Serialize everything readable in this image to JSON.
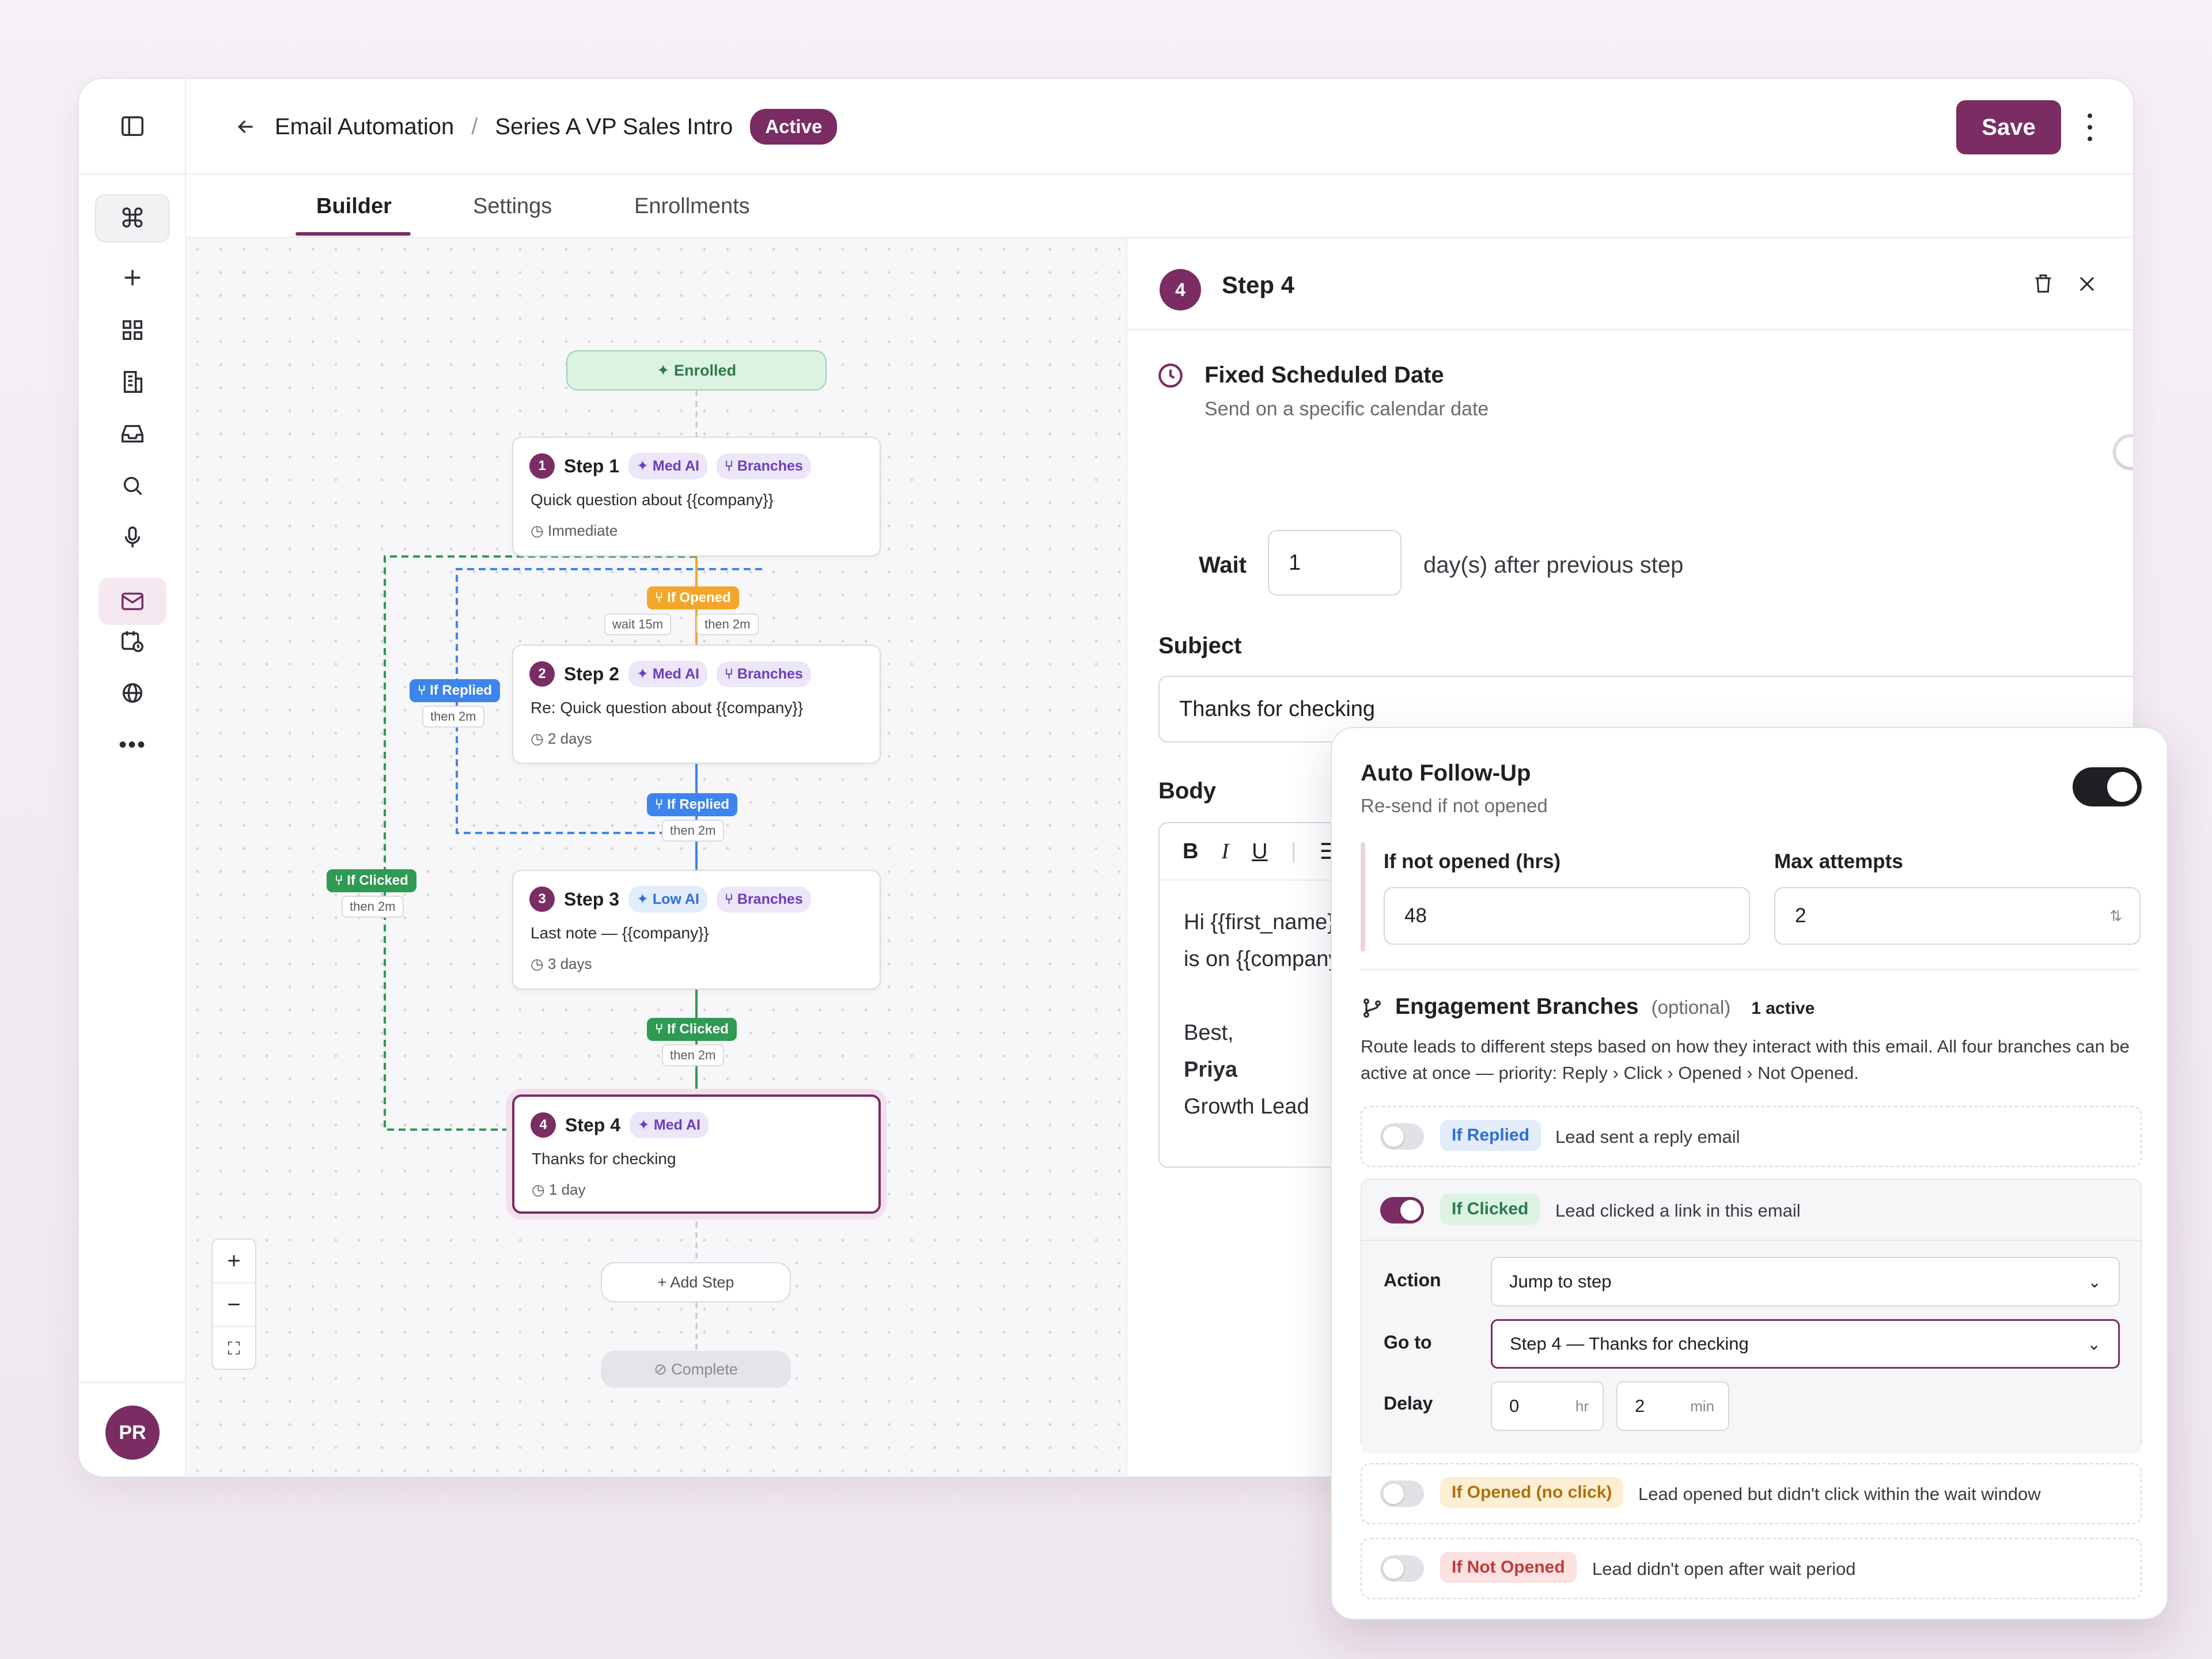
{
  "header": {
    "breadcrumb_root": "Email Automation",
    "breadcrumb_sep": "/",
    "breadcrumb_current": "Series A VP Sales Intro",
    "status_badge": "Active",
    "save_label": "Save"
  },
  "tabs": [
    {
      "label": "Builder",
      "active": true
    },
    {
      "label": "Settings",
      "active": false
    },
    {
      "label": "Enrollments",
      "active": false
    }
  ],
  "sidebar": {
    "icons": [
      "command-icon",
      "plus-icon",
      "dashboard-icon",
      "building-icon",
      "inbox-icon",
      "search-icon",
      "microphone-icon",
      "mail-icon",
      "calendar-icon",
      "globe-icon",
      "more-icon"
    ],
    "active": "mail-icon",
    "avatar_initials": "PR"
  },
  "canvas": {
    "enrolled_label": "✦ Enrolled",
    "steps": [
      {
        "num": "1",
        "title": "Step 1",
        "ai": "✦ Med AI",
        "ai_level": "med",
        "branches": "⑂ Branches",
        "subject": "Quick question about {{company}}",
        "delay": "◷ Immediate"
      },
      {
        "num": "2",
        "title": "Step 2",
        "ai": "✦ Med AI",
        "ai_level": "med",
        "branches": "⑂ Branches",
        "subject": "Re: Quick question about {{company}}",
        "delay": "◷ 2 days"
      },
      {
        "num": "3",
        "title": "Step 3",
        "ai": "✦ Low AI",
        "ai_level": "low",
        "branches": "⑂ Branches",
        "subject": "Last note — {{company}}",
        "delay": "◷ 3 days"
      },
      {
        "num": "4",
        "title": "Step 4",
        "ai": "✦ Med AI",
        "ai_level": "med",
        "branches": "",
        "subject": "Thanks for checking",
        "delay": "◷ 1 day"
      }
    ],
    "edge_labels": {
      "if_opened": "⑂ If Opened",
      "wait_15m": "wait 15m",
      "then_2m": "then 2m",
      "if_replied": "⑂ If Replied",
      "if_clicked": "⑂ If Clicked"
    },
    "add_step": "+ Add Step",
    "complete": "⊘ Complete",
    "zoom_in": "+",
    "zoom_out": "−",
    "fit": "⛶"
  },
  "panel": {
    "step_num": "4",
    "title": "Step 4",
    "fixed_date_title": "Fixed Scheduled Date",
    "fixed_date_sub": "Send on a specific calendar date",
    "fixed_date_on": false,
    "wait_label": "Wait",
    "wait_value": "1",
    "wait_after": "day(s) after previous step",
    "subject_label": "Subject",
    "subject_value": "Thanks for checking",
    "body_label": "Body",
    "toolbar": {
      "bold": "B",
      "italic": "I",
      "underline": "U",
      "bullets": "☰",
      "numbered": "≡"
    },
    "body_lines": [
      "Hi {{first_name}}, I'll ke",
      "is on {{company}}'s roa",
      "",
      "Best,",
      "Priya",
      "Growth Lead"
    ]
  },
  "followup": {
    "title": "Auto Follow-Up",
    "sub": "Re-send if not opened",
    "enabled": true,
    "if_not_opened_label": "If not opened (hrs)",
    "if_not_opened_value": "48",
    "max_attempts_label": "Max attempts",
    "max_attempts_value": "2",
    "branches_title": "Engagement Branches",
    "branches_optional": "(optional)",
    "branches_active": "1 active",
    "branches_desc": "Route leads to different steps based on how they interact with this email. All four branches can be active at once — priority: Reply › Click › Opened › Not Opened.",
    "branches": [
      {
        "tag": "If Replied",
        "desc": "Lead sent a reply email",
        "on": false
      },
      {
        "tag": "If Clicked",
        "desc": "Lead clicked a link in this email",
        "on": true
      },
      {
        "tag": "If Opened (no click)",
        "desc": "Lead opened but didn't click within the wait window",
        "on": false
      },
      {
        "tag": "If Not Opened",
        "desc": "Lead didn't open after wait period",
        "on": false
      }
    ],
    "action_label": "Action",
    "action_value": "Jump to step",
    "goto_label": "Go to",
    "goto_value": "Step 4 — Thanks for checking",
    "delay_label": "Delay",
    "delay_hr": "0",
    "delay_hr_unit": "hr",
    "delay_min": "2",
    "delay_min_unit": "min"
  },
  "colors": {
    "brand": "#7a2c63",
    "opened": "#f2a72c",
    "replied": "#3d85ec",
    "clicked": "#2e9a52",
    "not_opened": "#d64545"
  }
}
